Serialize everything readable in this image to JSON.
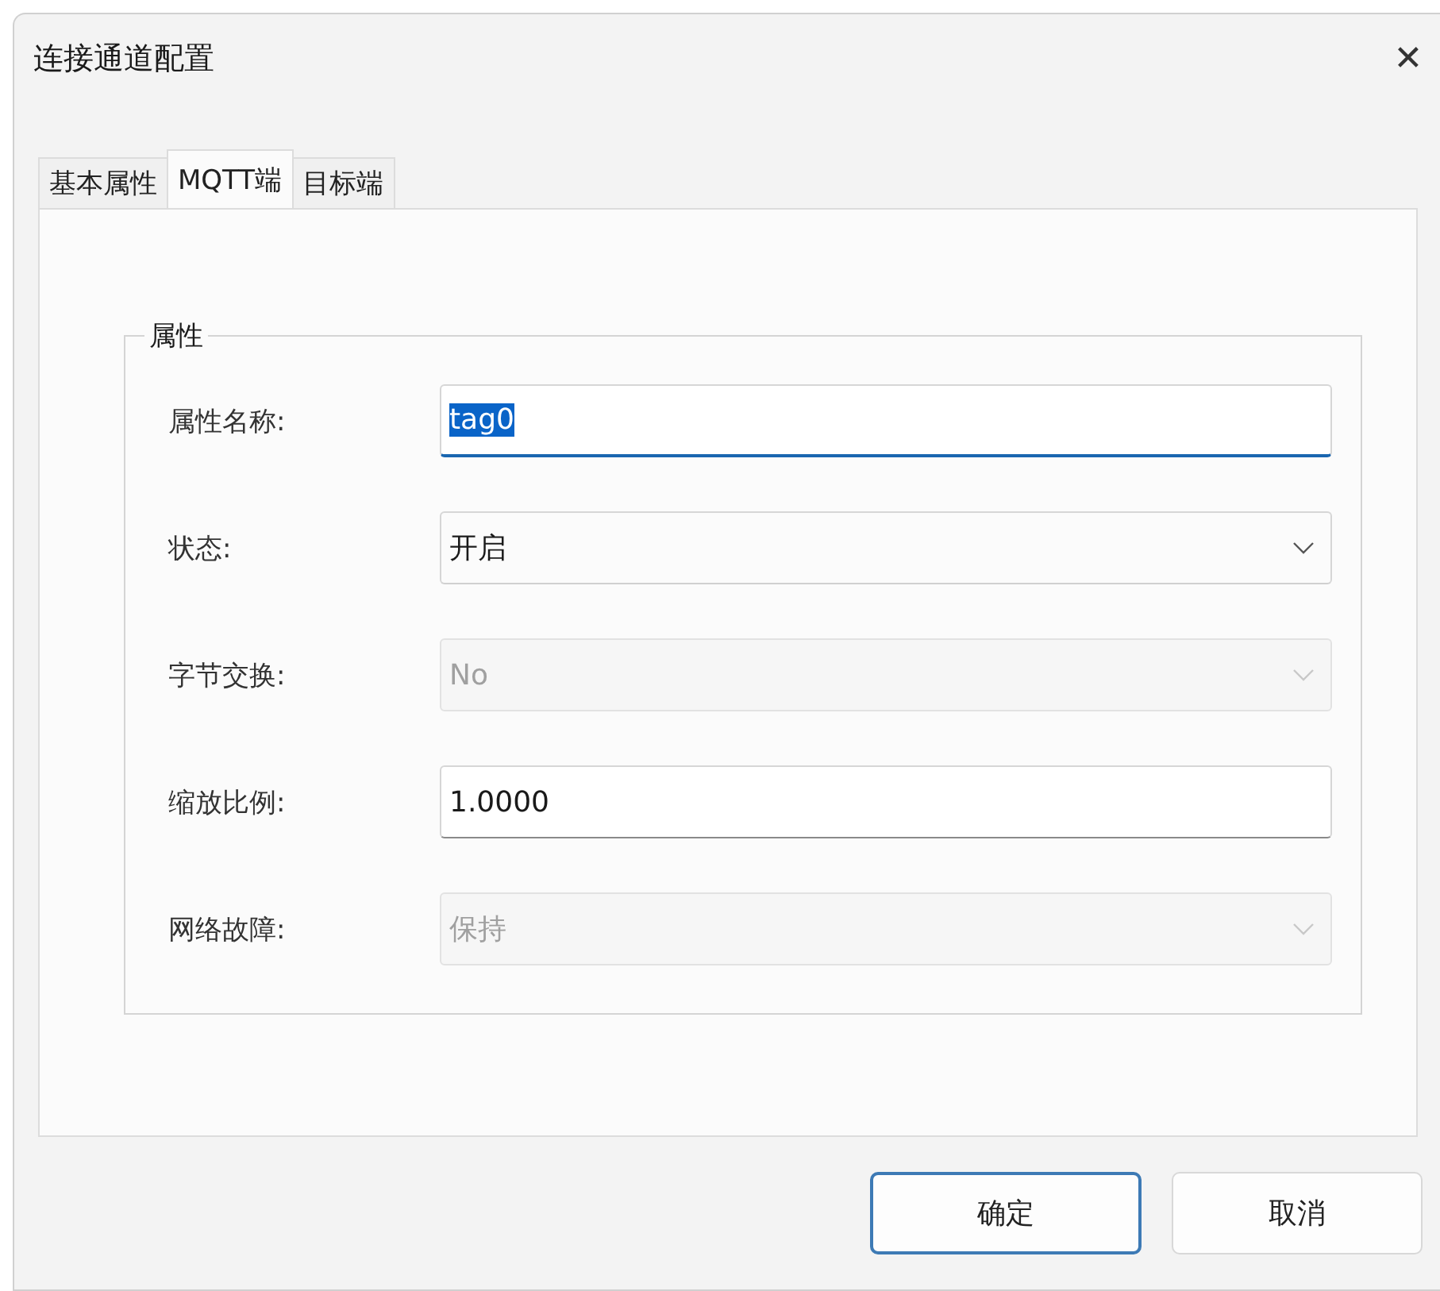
{
  "window": {
    "title": "连接通道配置",
    "close": "✕"
  },
  "tabs": [
    {
      "label": "基本属性",
      "selected": false
    },
    {
      "label": "MQTT端",
      "selected": true
    },
    {
      "label": "目标端",
      "selected": false
    }
  ],
  "group": {
    "title": "属性",
    "fields": [
      {
        "kind": "text",
        "label": "属性名称:",
        "value": "tag0",
        "disabled": false,
        "focused": true
      },
      {
        "kind": "select",
        "label": "状态:",
        "value": "开启",
        "disabled": false,
        "focused": false
      },
      {
        "kind": "select",
        "label": "字节交换:",
        "value": "No",
        "disabled": true,
        "focused": false
      },
      {
        "kind": "text",
        "label": "缩放比例:",
        "value": "1.0000",
        "disabled": false,
        "focused": false
      },
      {
        "kind": "select",
        "label": "网络故障:",
        "value": "保持",
        "disabled": true,
        "focused": false
      }
    ]
  },
  "buttons": [
    {
      "label": "确定",
      "default": true
    },
    {
      "label": "取消",
      "default": false
    }
  ]
}
